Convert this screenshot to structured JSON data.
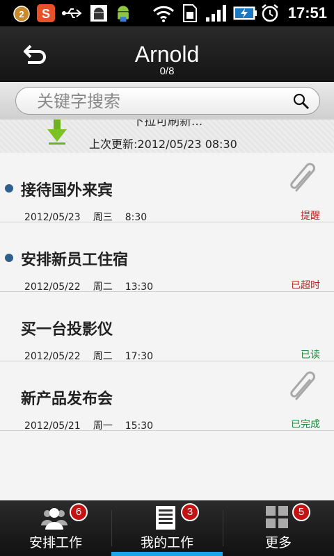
{
  "status_bar": {
    "time": "17:51",
    "notification_count": "2",
    "icons": [
      "notification-badge-icon",
      "sogou-input-icon",
      "usb-icon",
      "android-debug-icon",
      "android-app-icon",
      "wifi-icon",
      "sim-icon",
      "signal-icon",
      "battery-charging-icon",
      "alarm-icon"
    ]
  },
  "header": {
    "title": "Arnold",
    "subtitle": "0/8"
  },
  "search": {
    "placeholder": "关键字搜索"
  },
  "refresh": {
    "pull_text": "下拉可刷新...",
    "last_update": "上次更新:2012/05/23  08:30"
  },
  "tasks": [
    {
      "name": "接待国外来宾",
      "date": "2012/05/23",
      "weekday": "周三",
      "time": "8:30",
      "status": "提醒",
      "status_color": "#b5261e",
      "unread": true,
      "attachment": true
    },
    {
      "name": "安排新员工住宿",
      "date": "2012/05/22",
      "weekday": "周二",
      "time": "13:30",
      "status": "已超时",
      "status_color": "#b5261e",
      "unread": true,
      "attachment": false
    },
    {
      "name": "买一台投影仪",
      "date": "2012/05/22",
      "weekday": "周二",
      "time": "17:30",
      "status": "已读",
      "status_color": "#1b8a3a",
      "unread": false,
      "attachment": false
    },
    {
      "name": "新产品发布会",
      "date": "2012/05/21",
      "weekday": "周一",
      "time": "15:30",
      "status": "已完成",
      "status_color": "#1b8a3a",
      "unread": false,
      "attachment": true
    }
  ],
  "tabs": [
    {
      "label": "安排工作",
      "badge": "6",
      "icon": "people-icon",
      "active": false
    },
    {
      "label": "我的工作",
      "badge": "3",
      "icon": "document-icon",
      "active": true
    },
    {
      "label": "更多",
      "badge": "5",
      "icon": "grid-icon",
      "active": false
    }
  ],
  "colors": {
    "accent": "#1ea5e8",
    "unread_dot": "#2f5f8c",
    "badge": "#c21414"
  }
}
